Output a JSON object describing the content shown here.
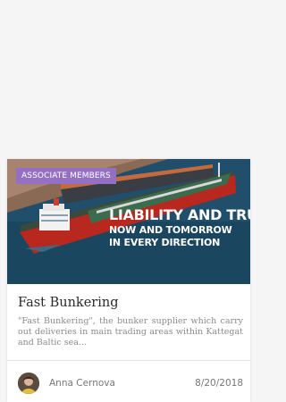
{
  "card": {
    "tag": "ASSOCIATE MEMBERS",
    "image_slogan": {
      "line1": "LIABILITY AND TRUS",
      "line2": "NOW AND TOMORROW",
      "line3": "IN EVERY DIRECTION"
    },
    "title": "Fast Bunkering",
    "excerpt": "\"Fast Bunkering\", the bunker supplier which carry out deliveries in main trading areas within Kattegat and Baltic sea...",
    "author": "Anna Cernova",
    "date": "8/20/2018"
  },
  "colors": {
    "tag_background": "#9370c4",
    "page_background": "#f5f5f5",
    "title": "#2b2b2b",
    "excerpt": "#8a8a8a",
    "meta": "#777777"
  }
}
